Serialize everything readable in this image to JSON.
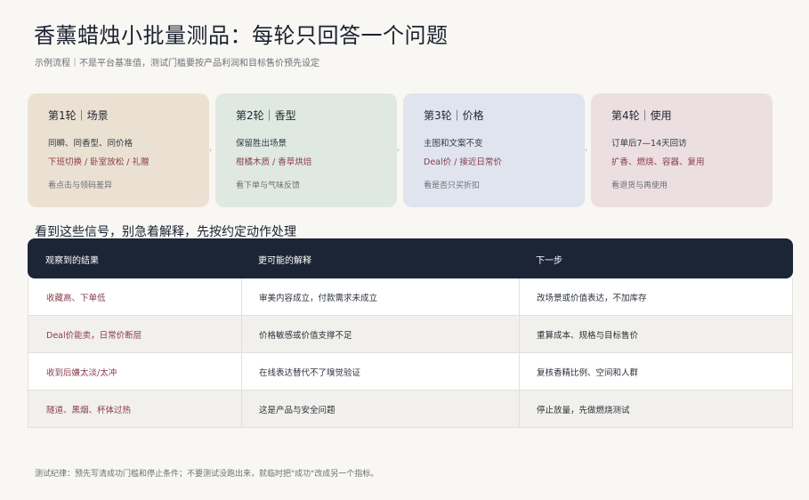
{
  "header": {
    "title": "香薰蜡烛小批量测品：每轮只回答一个问题",
    "subtitle": "示例流程｜不是平台基准值，测试门槛要按产品利润和目标售价预先设定"
  },
  "rounds": [
    {
      "title": "第1轮｜场景",
      "line1": "同瞬、同香型、同价格",
      "line2": "下班切换 / 卧室放松 / 礼赠",
      "line3": "看点击与领码差异",
      "bg": "#ebe1d2",
      "accent": "#8a3b4c"
    },
    {
      "title": "第2轮｜香型",
      "line1": "保留胜出场景",
      "line2": "柑橘木质 / 香草烘焙",
      "line3": "看下单与气味反馈",
      "bg": "#dfe9e2",
      "accent": "#8a3b4c"
    },
    {
      "title": "第3轮｜价格",
      "line1": "主图和文案不变",
      "line2": "Deal价 / 接近日常价",
      "line3": "看是否只买折扣",
      "bg": "#dfe4ee",
      "accent": "#8a3b4c"
    },
    {
      "title": "第4轮｜使用",
      "line1": "订单后7—14天回访",
      "line2": "扩香、燃烧、容器、复用",
      "line3": "看退货与再使用",
      "bg": "#ecdfe2",
      "accent": "#8a3b4c"
    }
  ],
  "arrow_glyph": "›",
  "section_heading": "看到这些信号，别急着解释，先按约定动作处理",
  "table": {
    "headers": [
      "观察到的结果",
      "更可能的解释",
      "下一步"
    ],
    "rows": [
      [
        "收藏高、下单低",
        "审美内容成立，付款需求未成立",
        "改场景或价值表达，不加库存"
      ],
      [
        "Deal价能卖，日常价断层",
        "价格敏感或价值支撑不足",
        "重算成本、规格与目标售价"
      ],
      [
        "收到后嫌太淡/太冲",
        "在线表达替代不了嗅觉验证",
        "复核香精比例、空间和人群"
      ],
      [
        "隧道、黑烟、杯体过热",
        "这是产品与安全问题",
        "停止放量，先做燃烧测试"
      ]
    ]
  },
  "footnote": "测试纪律：预先写清成功门槛和停止条件；不要测试没跑出来，就临时把\"成功\"改成另一个指标。",
  "colors": {
    "header_bg": "#1b2535",
    "accent": "#8a3b4c",
    "page_bg": "#f8f7f4"
  }
}
